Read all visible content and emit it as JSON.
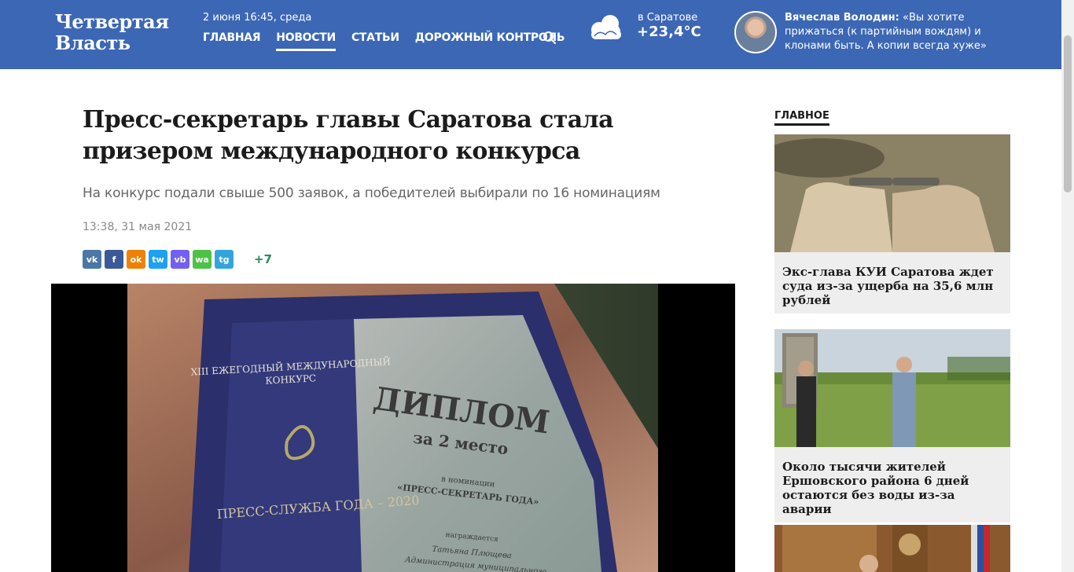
{
  "header": {
    "logo_line1": "Четвертая",
    "logo_line2": "Власть",
    "date": "2 июня 16:45, среда",
    "nav": [
      "ГЛАВНАЯ",
      "НОВОСТИ",
      "СТАТЬИ",
      "ДОРОЖНЫЙ КОНТРОЛЬ"
    ],
    "active_nav": "НОВОСТИ",
    "weather_city": "в Саратове",
    "weather_temp": "+23,4°C",
    "quote_author": "Вячеслав Володин:",
    "quote_text": "«Вы хотите прижаться (к партийным вождям) и клонами быть. А копии всегда хуже»"
  },
  "article": {
    "title": "Пресс-секретарь главы Саратова стала призером международного конкурса",
    "subtitle": "На конкурс подали свыше 500 заявок, а победителей выбирали по 16 номинациям",
    "date": "13:38, 31 мая 2021",
    "share_more": "+7",
    "share_buttons": [
      {
        "icon": "vk-icon",
        "label": "vk",
        "color": "#4a76a8"
      },
      {
        "icon": "facebook-icon",
        "label": "f",
        "color": "#3b5998"
      },
      {
        "icon": "odnoklassniki-icon",
        "label": "ok",
        "color": "#ee8208"
      },
      {
        "icon": "twitter-icon",
        "label": "tw",
        "color": "#1da1f2"
      },
      {
        "icon": "viber-icon",
        "label": "vb",
        "color": "#7360f2"
      },
      {
        "icon": "whatsapp-icon",
        "label": "wa",
        "color": "#4dc247"
      },
      {
        "icon": "telegram-icon",
        "label": "tg",
        "color": "#34a5dc"
      }
    ],
    "diploma": {
      "left_heading": "XIII ЕЖЕГОДНЫЙ МЕЖДУНАРОДНЫЙ КОНКУРС",
      "left_footer": "ПРЕСС-СЛУЖБА ГОДА – 2020",
      "right_title": "ДИПЛОМ",
      "right_place": "за 2 место",
      "right_nom": "в номинации",
      "right_nom_name": "«ПРЕСС-СЕКРЕТАРЬ ГОДА»",
      "right_award": "награждается",
      "right_name": "Татьяна Плющева",
      "right_org": "Администрация муниципального"
    }
  },
  "sidebar": {
    "title": "ГЛАВНОЕ",
    "cards": [
      {
        "title": "Экс-глава КУИ Саратова ждет суда из-за ущерба на 35,6 млн рублей"
      },
      {
        "title": "Около тысячи жителей Ершовского района 6 дней остаются без воды из-за аварии"
      },
      {
        "title": ""
      }
    ]
  },
  "colors": {
    "header_bg": "#3c67b5",
    "share_more": "#2e8b57"
  }
}
